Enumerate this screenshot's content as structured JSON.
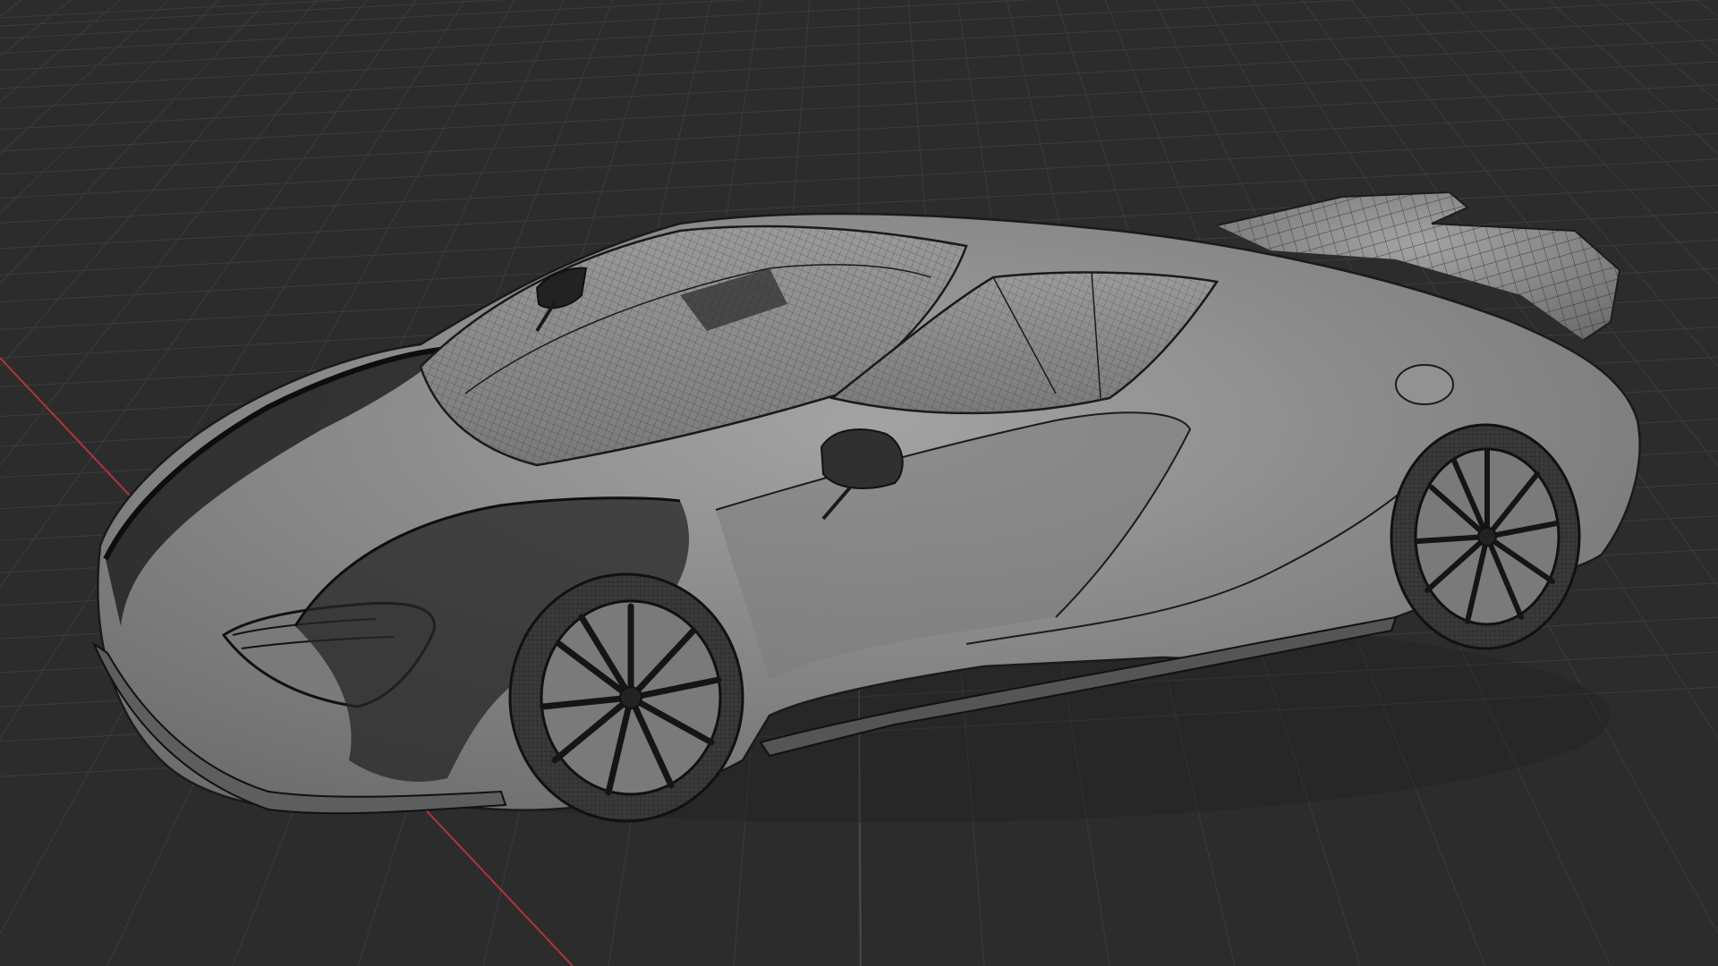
{
  "viewport": {
    "background_color": "#2c2c2c",
    "grid_color": "#3c3c3c",
    "x_axis_color": "#b0353b",
    "y_axis_color": "#4f4f4f",
    "model_fill_color": "#8c8c8c",
    "model_wire_color": "#1c1c1c",
    "grid_visible": true,
    "wireframe_overlay": true
  }
}
